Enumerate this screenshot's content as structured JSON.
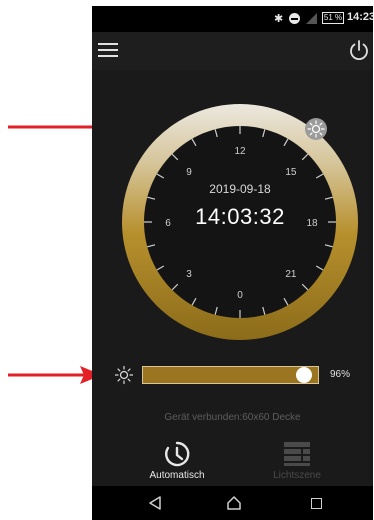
{
  "status_bar": {
    "battery": "51 %",
    "time": "14:23"
  },
  "clock": {
    "date": "2019-09-18",
    "time": "14:03:32",
    "hour_labels": [
      "12",
      "15",
      "18",
      "21",
      "0",
      "3",
      "6",
      "9"
    ]
  },
  "brightness": {
    "percent_label": "96%",
    "level": 0.96
  },
  "connection_status": "Gerät verbunden:60x60 Decke",
  "tabs": [
    {
      "label": "Automatisch",
      "icon": "clock-icon",
      "active": true
    },
    {
      "label": "Lichtszene",
      "icon": "list-icon",
      "active": false
    }
  ],
  "colors": {
    "accent_gold": "#9b7520",
    "arrow_red": "#e32026",
    "background": "#1a1a1a"
  }
}
